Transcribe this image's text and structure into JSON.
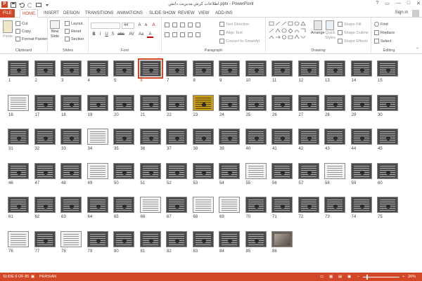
{
  "window": {
    "title": "اطلاعات کرش مدیریت دانش.pptx - PowerPoint",
    "controls": [
      "?",
      "▭",
      "—",
      "□",
      "✕"
    ],
    "sign_in": "Sign in"
  },
  "tabs": [
    "FILE",
    "HOME",
    "INSERT",
    "DESIGN",
    "TRANSITIONS",
    "ANIMATIONS",
    "SLIDE SHOW",
    "REVIEW",
    "VIEW",
    "ADD-INS"
  ],
  "active_tab": "HOME",
  "ribbon": {
    "clipboard": {
      "paste": "Paste",
      "cut": "Cut",
      "copy": "Copy",
      "format_painter": "Format Painter",
      "label": "Clipboard"
    },
    "slides": {
      "new_slide": "New",
      "new_slide_2": "Slide",
      "layout": "Layout",
      "reset": "Reset",
      "section": "Section",
      "label": "Slides"
    },
    "font": {
      "font_name": "",
      "font_size": "44",
      "bold": "B",
      "italic": "I",
      "underline": "U",
      "strike": "S",
      "shadow": "abc",
      "spacing": "AV",
      "case": "Aa",
      "color": "A",
      "grow": "A",
      "shrink": "A",
      "clear": "A",
      "label": "Font"
    },
    "paragraph": {
      "text_direction": "Text Direction",
      "align_text": "Align Text",
      "convert_smartart": "Convert to SmartArt",
      "label": "Paragraph"
    },
    "drawing": {
      "arrange": "Arrange",
      "quick_styles": "Quick",
      "quick_styles_2": "Styles",
      "shape_fill": "Shape Fill",
      "shape_outline": "Shape Outline",
      "shape_effects": "Shape Effects",
      "label": "Drawing"
    },
    "editing": {
      "find": "Find",
      "replace": "Replace",
      "select": "Select",
      "label": "Editing"
    }
  },
  "slides": {
    "count": 86,
    "selected": 6,
    "light": [
      16,
      34,
      49,
      55,
      58,
      66,
      68,
      69,
      76,
      78
    ],
    "gold": [
      23
    ],
    "photo": [
      86
    ]
  },
  "status": {
    "slide_info": "SLIDE 6 OF 86",
    "language": "PERSIAN",
    "zoom": "20%",
    "zoom_level": 0.2
  },
  "colors": {
    "accent": "#d24726",
    "thumb_dark": "#4a4a4a"
  }
}
